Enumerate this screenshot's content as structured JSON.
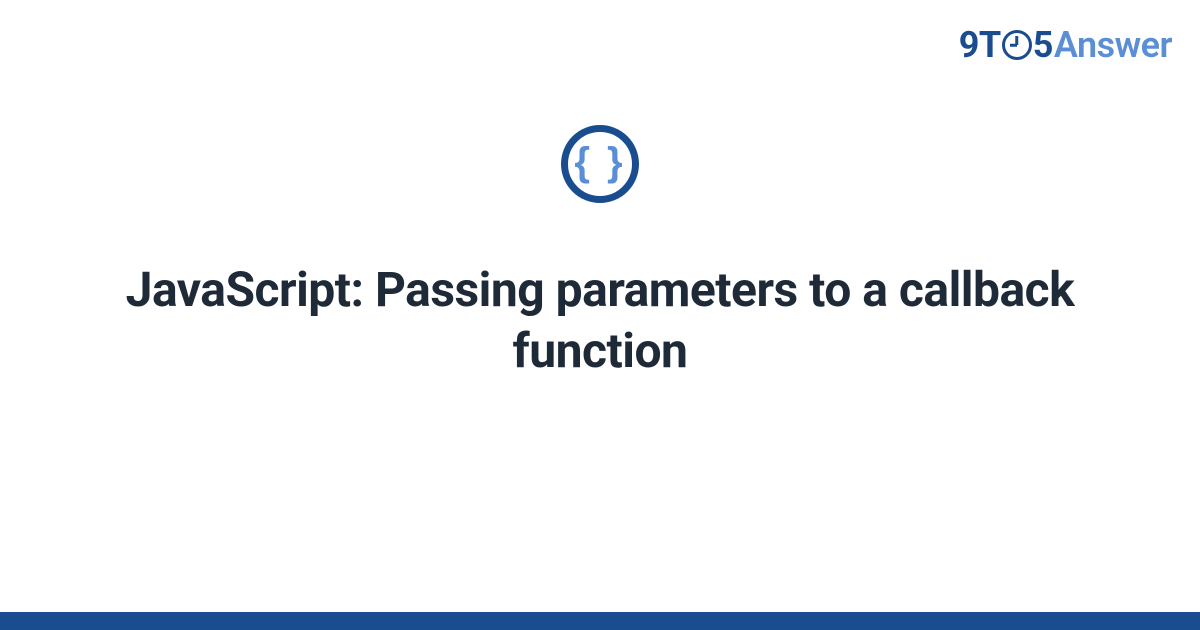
{
  "brand": {
    "part1": "9",
    "part2": "T",
    "part3": "5",
    "part4": "Answer"
  },
  "icon": {
    "braces_glyph": "{ }",
    "semantic": "javascript-braces"
  },
  "title": "JavaScript: Passing parameters to a callback function",
  "colors": {
    "primary": "#1a4d8f",
    "accent": "#5a8fd6",
    "text": "#1e2a38",
    "background": "#ffffff"
  }
}
